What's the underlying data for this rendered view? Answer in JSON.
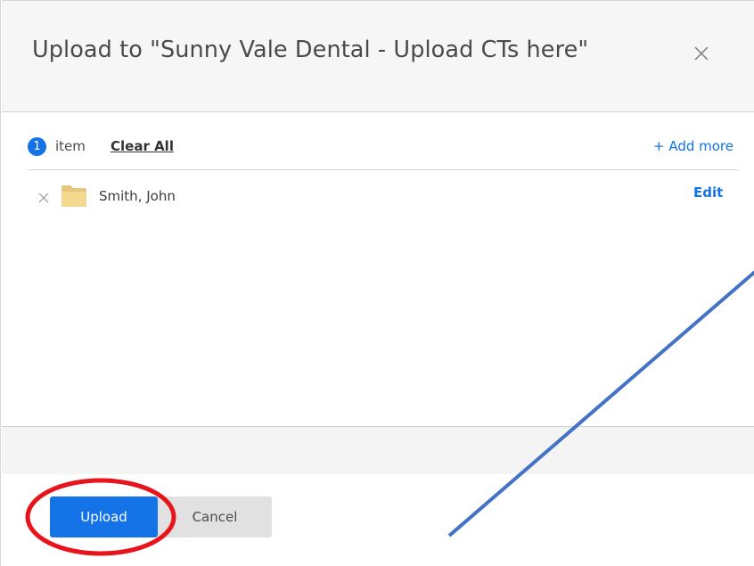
{
  "dialog": {
    "title": "Upload to \"Sunny Vale Dental - Upload CTs here\"",
    "close_icon": "close-icon"
  },
  "summary": {
    "count": "1",
    "count_label": "item",
    "clear_all_label": "Clear All",
    "add_more_label": "+ Add more"
  },
  "items": [
    {
      "name": "Smith, John",
      "icon": "folder-icon",
      "edit_label": "Edit",
      "remove_icon": "remove-icon"
    }
  ],
  "footer": {
    "upload_label": "Upload",
    "cancel_label": "Cancel"
  },
  "colors": {
    "accent": "#1473e6",
    "annotation_circle": "#e8141b",
    "annotation_line": "#4472c4",
    "folder": "#f0d089"
  }
}
